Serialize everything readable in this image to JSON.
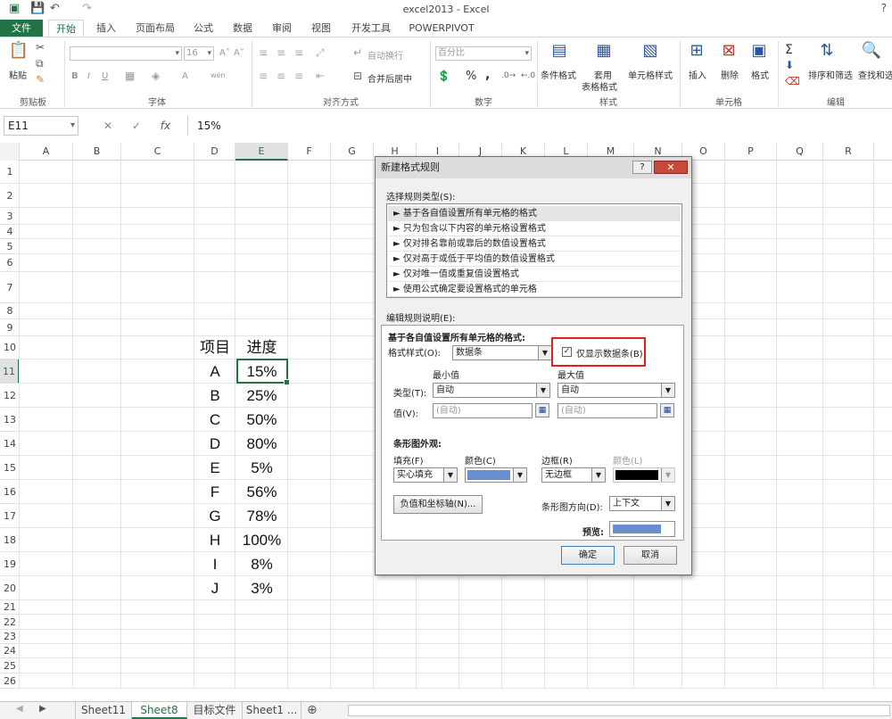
{
  "window": {
    "title": "excel2013 - Excel",
    "help": "?"
  },
  "ribbon": {
    "tabs": [
      "文件",
      "开始",
      "插入",
      "页面布局",
      "公式",
      "数据",
      "审阅",
      "视图",
      "开发工具",
      "POWERPIVOT"
    ],
    "clipboard": {
      "paste": "粘贴",
      "group": "剪贴板"
    },
    "font": {
      "size": "16",
      "bold": "B",
      "italic": "I",
      "underline": "U",
      "grow": "A˄",
      "shrink": "A˅",
      "color": "A",
      "phonetic": "wén",
      "group": "字体"
    },
    "alignment": {
      "wrap": "自动换行",
      "merge": "合并后居中",
      "group": "对齐方式"
    },
    "number": {
      "format": "百分比",
      "percent": "%",
      "comma": ",",
      "group": "数字"
    },
    "styles": {
      "conditional": "条件格式",
      "table_1": "套用",
      "table_2": "表格格式",
      "cell_style": "单元格样式",
      "group": "样式"
    },
    "cells": {
      "insert": "插入",
      "delete": "删除",
      "format": "格式",
      "group": "单元格"
    },
    "editing": {
      "sort": "排序和筛选",
      "find": "查找和选",
      "sum": "Σ",
      "group": "编辑"
    }
  },
  "formula_bar": {
    "name_box": "E11",
    "cancel": "✕",
    "confirm": "✓",
    "fx": "fx",
    "value": "15%"
  },
  "grid": {
    "columns": [
      "A",
      "B",
      "C",
      "D",
      "E",
      "F",
      "G",
      "H",
      "I",
      "J",
      "K",
      "L",
      "M",
      "N",
      "O",
      "P",
      "Q",
      "R"
    ],
    "rows": [
      "1",
      "2",
      "3",
      "4",
      "5",
      "6",
      "7",
      "8",
      "9",
      "10",
      "11",
      "12",
      "13",
      "14",
      "15",
      "16",
      "17",
      "18",
      "19",
      "20",
      "21",
      "22",
      "23",
      "24",
      "25",
      "26"
    ],
    "header_item": "项目",
    "header_progress": "进度",
    "items": [
      "A",
      "B",
      "C",
      "D",
      "E",
      "F",
      "G",
      "H",
      "I",
      "J"
    ],
    "progress": [
      "15%",
      "25%",
      "50%",
      "80%",
      "5%",
      "56%",
      "78%",
      "100%",
      "8%",
      "3%"
    ]
  },
  "sheets": {
    "tabs": [
      "Sheet11",
      "Sheet8",
      "目标文件",
      "Sheet1 ..."
    ],
    "active": "Sheet8",
    "add": "⊕"
  },
  "dialog": {
    "title": "新建格式规则",
    "help": "?",
    "close": "✕",
    "select_type_label": "选择规则类型(S):",
    "rule_types": [
      "► 基于各自值设置所有单元格的格式",
      "► 只为包含以下内容的单元格设置格式",
      "► 仅对排名靠前或靠后的数值设置格式",
      "► 仅对高于或低于平均值的数值设置格式",
      "► 仅对唯一值或重复值设置格式",
      "► 使用公式确定要设置格式的单元格"
    ],
    "edit_label": "编辑规则说明(E):",
    "edit_heading": "基于各自值设置所有单元格的格式:",
    "format_style_label": "格式样式(O):",
    "format_style_value": "数据条",
    "show_bar_only": "仅显示数据条(B)",
    "show_bar_checked": "✓",
    "min_label": "最小值",
    "max_label": "最大值",
    "type_label": "类型(T):",
    "min_type": "自动",
    "max_type": "自动",
    "value_label": "值(V):",
    "min_value": "(自动)",
    "max_value": "(自动)",
    "appearance_label": "条形图外观:",
    "fill_label": "填充(F)",
    "color_label": "颜色(C)",
    "border_label": "边框(R)",
    "border_color_label": "颜色(L)",
    "fill_value": "实心填充",
    "border_value": "无边框",
    "fill_color": "#6a8fcf",
    "border_color": "#000000",
    "axis_button": "负值和坐标轴(N)...",
    "direction_label": "条形图方向(D):",
    "direction_value": "上下文",
    "preview_label": "预览:",
    "ok": "确定",
    "cancel": "取消"
  }
}
